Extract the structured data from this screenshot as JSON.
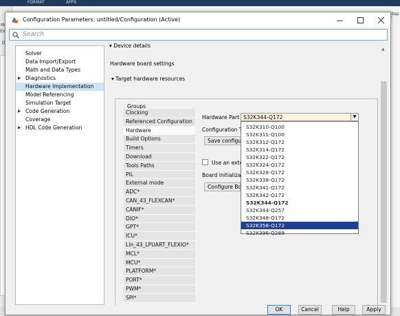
{
  "background": {
    "ribbon_tabs": [
      "FORMAT",
      "APPS"
    ],
    "left_labels": [
      "Mo",
      "Expl",
      "DE"
    ],
    "right_label": "Step T"
  },
  "dialog": {
    "title": "Configuration Parameters: untitled/Configuration (Active)",
    "search_placeholder": "Search",
    "tree": [
      {
        "label": "Solver",
        "arrow": ""
      },
      {
        "label": "Data Import/Export",
        "arrow": ""
      },
      {
        "label": "Math and Data Types",
        "arrow": ""
      },
      {
        "label": "Diagnostics",
        "arrow": "▶"
      },
      {
        "label": "Hardware Implementation",
        "arrow": ""
      },
      {
        "label": "Model Referencing",
        "arrow": ""
      },
      {
        "label": "Simulation Target",
        "arrow": ""
      },
      {
        "label": "Code Generation",
        "arrow": "▶"
      },
      {
        "label": "Coverage",
        "arrow": ""
      },
      {
        "label": "HDL Code Generation",
        "arrow": "▶"
      }
    ],
    "device_details": "Device details",
    "hardware_board_settings": "Hardware board settings",
    "target_hardware_resources": "Target hardware resources",
    "groups_label": "Groups",
    "groups": [
      "Clocking",
      "Referenced Configuration",
      "Hardware",
      "Build Options",
      "Timers",
      "Download",
      "Tools Paths",
      "PIL",
      "External mode",
      "ADC*",
      "CAN_43_FLEXCAN*",
      "CANIF*",
      "DIO*",
      "GPT*",
      "ICU*",
      "Lin_43_LPUART_FLEXIO*",
      "MCL*",
      "MCU*",
      "PLATFORM*",
      "PORT*",
      "PWM*",
      "SPI*"
    ],
    "hardware_part_label": "Hardware Part",
    "hardware_part_value": "S32K344-Q172",
    "configuration_label": "Configuration Te",
    "save_config_button": "Save configura",
    "use_external_label": "Use an exter",
    "board_init_label": "Board Initializati",
    "configure_board_button": "Configure Boa",
    "dropdown_options": [
      "S32K310-Q100",
      "S32K311-Q100",
      "S32K312-Q172",
      "S32K314-Q172",
      "S32K322-Q172",
      "S32K324-Q172",
      "S32K328-Q172",
      "S32K338-Q172",
      "S32K341-Q172",
      "S32K342-Q172",
      "S32K344-Q172",
      "S32K344-Q257",
      "S32K348-Q172",
      "S32K358-Q172",
      "S32K396-Q289"
    ],
    "dropdown_current": "S32K344-Q172",
    "dropdown_highlight": "S32K358-Q172",
    "ok": "OK",
    "cancel": "Cancel",
    "help": "Help",
    "apply": "Apply"
  },
  "colors": {
    "selection": "#1f3f8f",
    "tree_selection": "#cde4f7",
    "combo_background": "#fdf3df"
  }
}
